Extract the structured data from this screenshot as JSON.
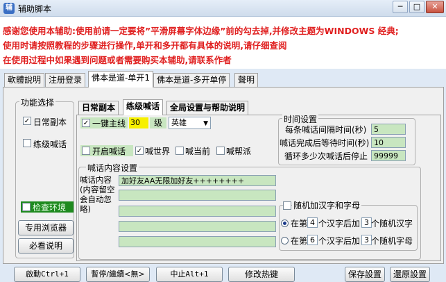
{
  "window": {
    "title": "辅助脚本",
    "icon_letter": "辅",
    "minimize": "─",
    "maximize": "□",
    "close": "✕"
  },
  "notice": [
    "感谢您使用本辅助:使用前请一定要将”平滑屏幕字体边缘”前的勾去掉,并修改主题为WINDOWS 经典;",
    "使用时请按照教程的步骤进行操作,单开和多开都有具体的说明,请仔细查阅",
    "在使用过程中如果遇到问题或者需要购买本辅助,请联系作者"
  ],
  "tabs": [
    "軟體說明",
    "注册登录",
    "佛本是道-单开1",
    "佛本是道-多开单停",
    "聲明"
  ],
  "left": {
    "group_title": "功能选择",
    "daily": "日常副本",
    "practice": "练级喊话",
    "check_env": "检查环境",
    "browser_btn": "专用浏览器",
    "guide_btn": "必看说明"
  },
  "subtabs": [
    "日常副本",
    "练级喊话",
    "全局设置与帮助说明"
  ],
  "practice": {
    "one_key": "一键主线",
    "level_value": "30",
    "level_label": "级",
    "hero": "英雄",
    "open_shout": "开启喊话",
    "shout_world": "喊世界",
    "shout_current": "喊当前",
    "shout_guild": "喊帮派"
  },
  "time": {
    "title": "时间设置",
    "interval_label": "每条喊话间隔时间(秒)",
    "interval_value": "5",
    "wait_label": "喊话完成后等待时间(秒)",
    "wait_value": "10",
    "loop_label": "循环多少次喊话后停止",
    "loop_value": "99999"
  },
  "content": {
    "title": "喊话内容设置",
    "label": "喊话内容 (内容留空会自动忽略)",
    "lines": [
      "加好友AA无限加好友++++++++",
      "",
      "",
      "",
      ""
    ]
  },
  "random": {
    "checkbox": "随机加汉字和字母",
    "row1_prefix": "在第",
    "row1_n": "4",
    "row1_mid": "个汉字后加",
    "row1_m": "3",
    "row1_suffix": "个随机汉字",
    "row2_prefix": "在第",
    "row2_n": "6",
    "row2_mid": "个汉字后加",
    "row2_m": "3",
    "row2_suffix": "个随机字母"
  },
  "buttons": {
    "start": "啟動Ctrl+1",
    "pause": "暫停/繼續<無>",
    "stop": "中止Alt+1",
    "hotkey": "修改热键",
    "save": "保存設置",
    "restore": "還原設置"
  }
}
